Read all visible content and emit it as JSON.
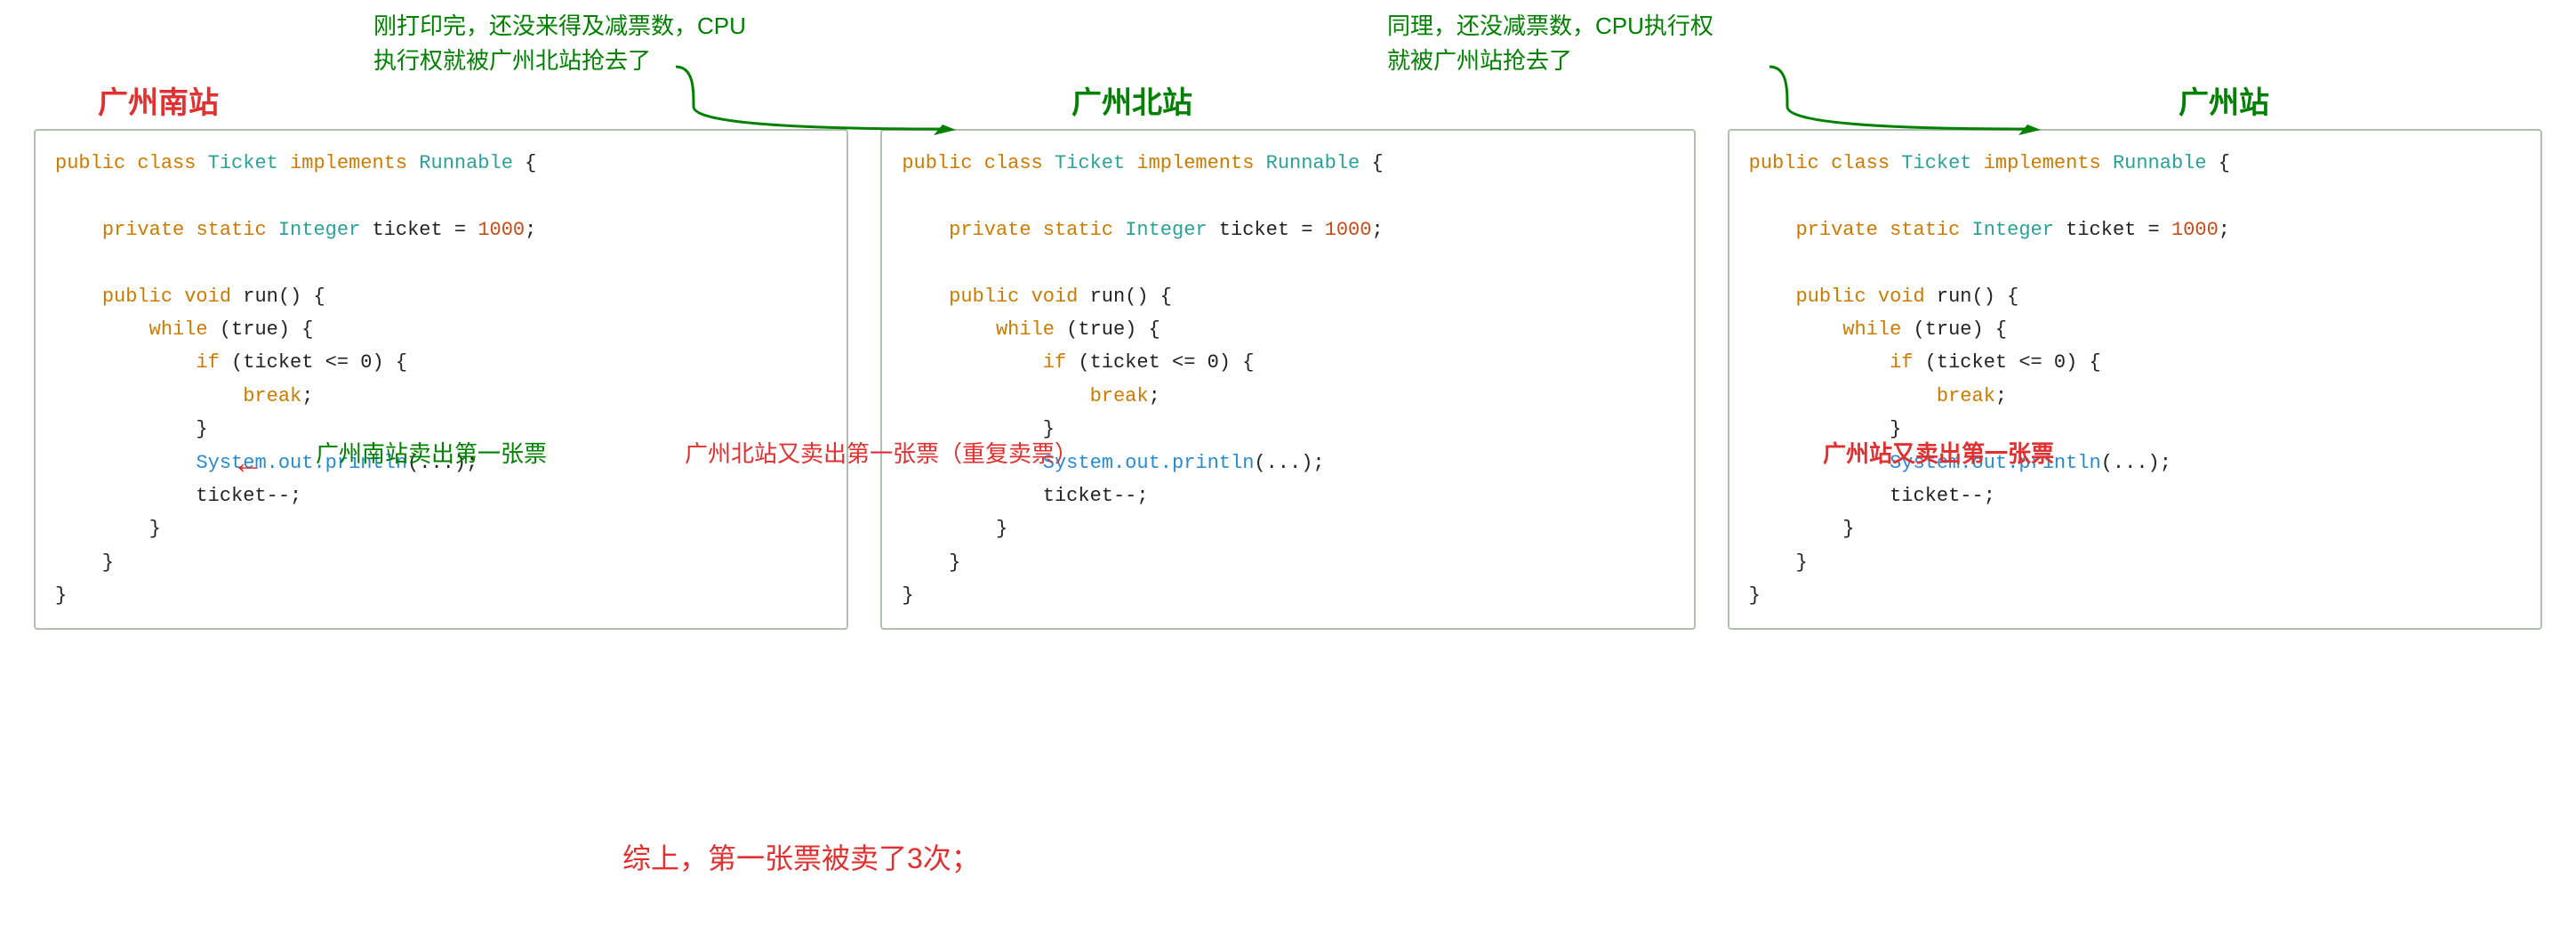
{
  "annotations": {
    "top_left_line1": "刚打印完，还没来得及减票数，CPU",
    "top_left_line2": "执行权就被广州北站抢去了",
    "top_right_line1": "同理，还没减票数，CPU执行权",
    "top_right_line2": "就被广州站抢去了",
    "label_south": "广州南站",
    "label_north": "广州北站",
    "label_gz": "广州站",
    "annotation_south_sell": "广州南站卖出第一张票",
    "annotation_north_sell": "广州北站又卖出第一张票（重复卖票）",
    "annotation_gz_sell": "广州站又卖出第一张票",
    "summary": "综上，第一张票被卖了3次；"
  },
  "code": {
    "line1": "public class Ticket implements Runnable {",
    "line2": "    private static Integer ticket = 1000;",
    "line3": "    public void run() {",
    "line4": "        while (true) {",
    "line5": "            if (ticket <= 0) {",
    "line6": "                break;",
    "line7": "            }",
    "line8": "            System.out.println(...);",
    "line9": "            ticket--;",
    "line10": "        }",
    "line11": "    }",
    "line12": "}"
  }
}
